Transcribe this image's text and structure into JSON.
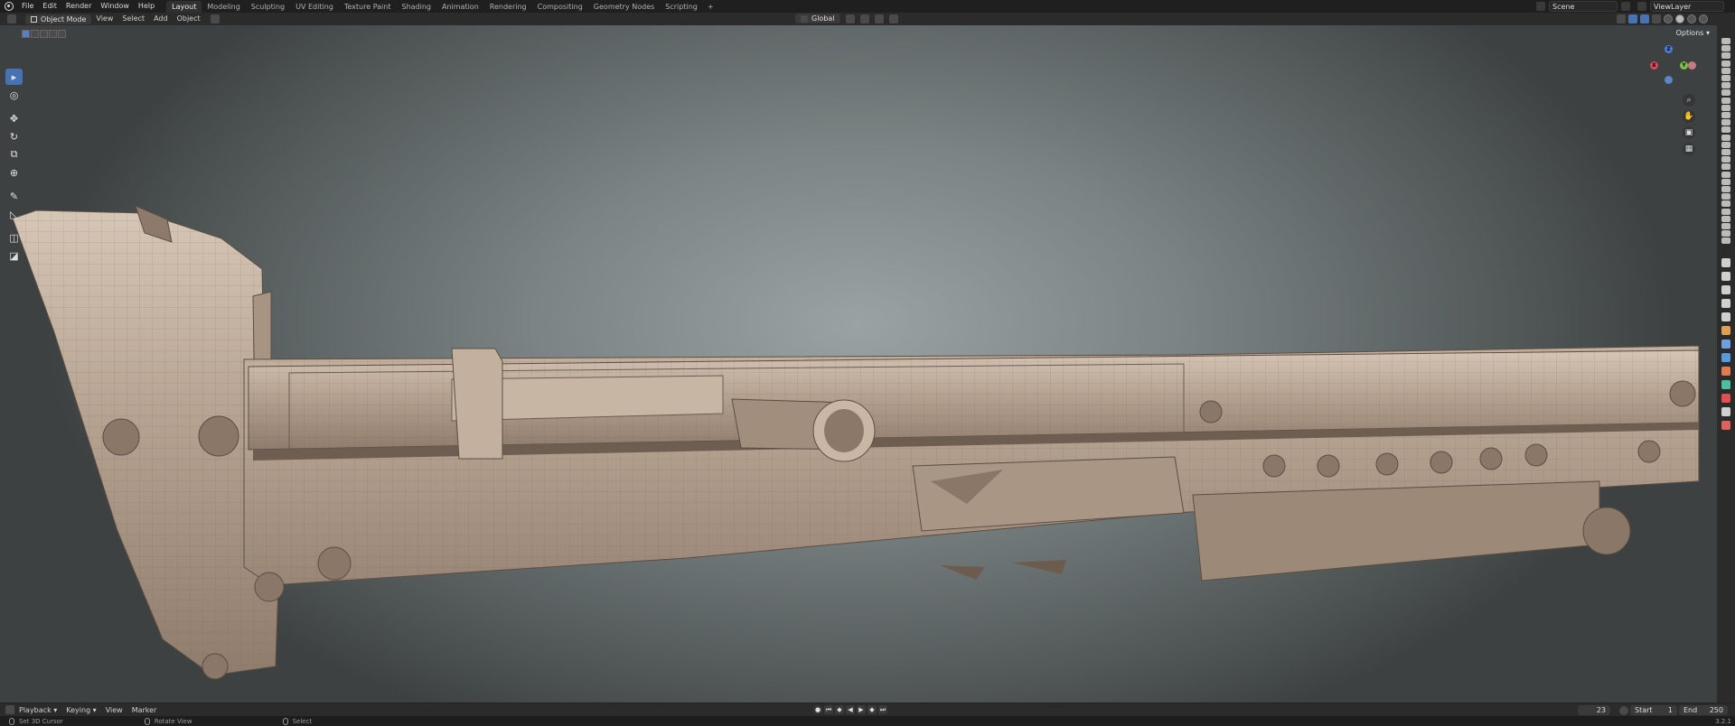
{
  "menu": [
    "File",
    "Edit",
    "Render",
    "Window",
    "Help"
  ],
  "workspaces": [
    "Layout",
    "Modeling",
    "Sculpting",
    "UV Editing",
    "Texture Paint",
    "Shading",
    "Animation",
    "Rendering",
    "Compositing",
    "Geometry Nodes",
    "Scripting"
  ],
  "active_workspace": "Layout",
  "add_workspace": "+",
  "scene": "Scene",
  "view_layer": "ViewLayer",
  "viewport_header": {
    "mode": "Object Mode",
    "view": "View",
    "select": "Select",
    "add": "Add",
    "object": "Object",
    "transform_orientation": "Global"
  },
  "options_label": "Options",
  "gizmo": {
    "x": "X",
    "y": "Y",
    "z": "Z"
  },
  "timeline": {
    "playback": "Playback",
    "keying": "Keying",
    "view": "View",
    "marker": "Marker",
    "current_frame": "23",
    "start_label": "Start",
    "start": "1",
    "end_label": "End",
    "end": "250"
  },
  "status": {
    "left": "Set 3D Cursor",
    "middle": "Rotate View",
    "right": "Select",
    "version": "3.2.1"
  },
  "colors": {
    "accent": "#4772b3",
    "model": "#b6a291",
    "background": "#1d1d1d"
  }
}
